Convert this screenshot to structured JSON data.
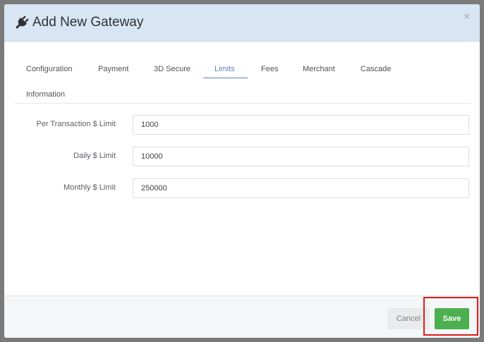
{
  "modal": {
    "title": "Add New Gateway",
    "close_symbol": "×",
    "header_icon": "plug-icon"
  },
  "tabs": [
    {
      "label": "Configuration",
      "active": false
    },
    {
      "label": "Payment",
      "active": false
    },
    {
      "label": "3D Secure",
      "active": false
    },
    {
      "label": "Limits",
      "active": true
    },
    {
      "label": "Fees",
      "active": false
    },
    {
      "label": "Merchant",
      "active": false
    },
    {
      "label": "Cascade",
      "active": false
    },
    {
      "label": "Information",
      "active": false
    }
  ],
  "form": {
    "per_transaction": {
      "label": "Per Transaction $ Limit",
      "value": "1000"
    },
    "daily": {
      "label": "Daily $ Limit",
      "value": "10000"
    },
    "monthly": {
      "label": "Monthly $ Limit",
      "value": "250000"
    }
  },
  "footer": {
    "cancel_label": "Cancel",
    "save_label": "Save"
  },
  "colors": {
    "header_bg": "#d7e6f2",
    "active_tab": "#5b7fc4",
    "save_button": "#4caf50",
    "highlight": "#e01b1b"
  }
}
